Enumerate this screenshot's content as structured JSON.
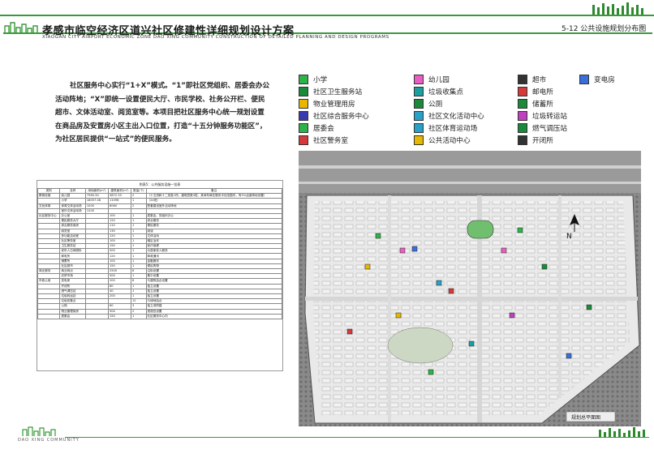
{
  "header": {
    "title": "孝感市临空经济区道兴社区修建性详细规划设计方案",
    "subtitle": "XIAOGAN CITY AIRPORT ECONOMIC ZONE DAO XING COMMUNITY CONSTRUCTION OF DETAILED PLANNING AND DESIGN PROGRAMS",
    "page_label": "5-12  公共设施规划分布图"
  },
  "intro": {
    "paragraph": "社区服务中心实行“1+X”模式。“1”即社区党组织、居委会办公活动阵地；“X”即统一设置便民大厅、市民学校、社务公开栏、便民超市、文体活动室、阅览室等。本项目把社区服务中心统一规划设置在商品房及安置房小区主出入口位置，打造“十五分钟服务功能区”，为社区居民提供“一站式”的便民服务。"
  },
  "legend": [
    {
      "label": "小学",
      "icon": "school-icon",
      "color": "#2db34a"
    },
    {
      "label": "幼儿园",
      "icon": "kindergarten-icon",
      "color": "#e85fc2"
    },
    {
      "label": "超市",
      "icon": "supermarket-icon",
      "color": "#333333"
    },
    {
      "label": "变电房",
      "icon": "substation-icon",
      "color": "#3a6fd8"
    },
    {
      "label": "社区卫生服务站",
      "icon": "health-station-icon",
      "color": "#1a8a3a"
    },
    {
      "label": "垃圾收集点",
      "icon": "garbage-point-icon",
      "color": "#1aa0a0"
    },
    {
      "label": "邮电所",
      "icon": "post-office-icon",
      "color": "#d43a3a"
    },
    {
      "label": "物业管理用房",
      "icon": "property-management-icon",
      "color": "#e6b800"
    },
    {
      "label": "公厕",
      "icon": "toilet-icon",
      "color": "#1a8a3a"
    },
    {
      "label": "储蓄所",
      "icon": "savings-bank-icon",
      "color": "#1a8a3a"
    },
    {
      "label": "社区综合服务中心",
      "icon": "community-center-icon",
      "color": "#3a3ab0"
    },
    {
      "label": "社区文化活动中心",
      "icon": "culture-center-icon",
      "color": "#2aa0c8"
    },
    {
      "label": "垃圾转运站",
      "icon": "garbage-transfer-icon",
      "color": "#c040c0"
    },
    {
      "label": "居委会",
      "icon": "residents-committee-icon",
      "color": "#2db34a"
    },
    {
      "label": "社区体育运动场",
      "icon": "sports-field-icon",
      "color": "#2aa0c8"
    },
    {
      "label": "燃气调压站",
      "icon": "gas-station-icon",
      "color": "#1a8a3a"
    },
    {
      "label": "社区警务室",
      "icon": "police-room-icon",
      "color": "#d43a3a"
    },
    {
      "label": "公共活动中心",
      "icon": "activity-center-icon",
      "color": "#e6b800"
    },
    {
      "label": "开闭所",
      "icon": "switching-station-icon",
      "color": "#333333"
    }
  ],
  "table": {
    "caption": "附表5：公共服务设施一览表",
    "headers": [
      "类别",
      "名称",
      "用地面积(m²)",
      "建筑面积(m²)",
      "数量(个)",
      "备注"
    ],
    "rows": [
      [
        "教育设施",
        "幼儿园",
        "7565.30",
        "5872.33",
        "2",
        "（十五班和十二班各1所，建筑层数3层，其间布局在服务半径范围内，有5%运营场地设置）"
      ],
      [
        "",
        "小学",
        "18057.08",
        "11096",
        "1",
        "（24班）"
      ],
      [
        "文化体育",
        "体育文体活动场",
        "1000",
        "8060",
        "2",
        "配套建设室外活动场地"
      ],
      [
        "",
        "室外文体活动场",
        "1200",
        "",
        "",
        ""
      ],
      [
        "社区服务中心",
        "办公室",
        "",
        "100",
        "1",
        "居委会、党组织办公"
      ],
      [
        "",
        "便民服务大厅",
        "",
        "120",
        "1",
        "综合服务"
      ],
      [
        "",
        "综合服务用房",
        "",
        "110",
        "1",
        "便民服务"
      ],
      [
        "",
        "阅览室",
        "",
        "130",
        "1",
        "阅读"
      ],
      [
        "",
        "多功能活动室",
        "",
        "120",
        "1",
        "文体活动"
      ],
      [
        "",
        "社区警务室",
        "",
        "100",
        "1",
        "辖区治安"
      ],
      [
        "",
        "卫生服务站",
        "",
        "150",
        "1",
        "医疗保健"
      ],
      [
        "",
        "老年人日间照料",
        "",
        "500",
        "1",
        "为居家老人服务"
      ],
      [
        "",
        "邮电所",
        "",
        "120",
        "1",
        "邮政通讯"
      ],
      [
        "",
        "储蓄所",
        "",
        "100",
        "1",
        "金融服务"
      ],
      [
        "",
        "社区超市",
        "",
        "150",
        "1",
        "便民购物"
      ],
      [
        "商业服务",
        "商业网点",
        "",
        "2500",
        "6",
        "沿街设置"
      ],
      [
        "",
        "农贸市场",
        "",
        "500",
        "1",
        "集中设置"
      ],
      [
        "市政公用",
        "变电房",
        "",
        "200",
        "8",
        "与建筑结合设置"
      ],
      [
        "",
        "开闭所",
        "",
        "80",
        "1",
        "独立设置"
      ],
      [
        "",
        "燃气调压站",
        "",
        "40",
        "1",
        "独立设置"
      ],
      [
        "",
        "垃圾转运站",
        "",
        "200",
        "1",
        "独立设置"
      ],
      [
        "",
        "垃圾收集点",
        "",
        "",
        "12",
        "与绿地结合"
      ],
      [
        "",
        "公厕",
        "",
        "60",
        "3",
        "独立或附建"
      ],
      [
        "",
        "物业管理用房",
        "",
        "504",
        "2",
        "按规范设置"
      ],
      [
        "",
        "居委会",
        "",
        "150",
        "1",
        "社区服务中心内"
      ]
    ]
  },
  "map": {
    "north_label": "N",
    "scale_label": "规划总平面图"
  },
  "footer": {
    "brand": "DAO XING COMMUNITY"
  }
}
